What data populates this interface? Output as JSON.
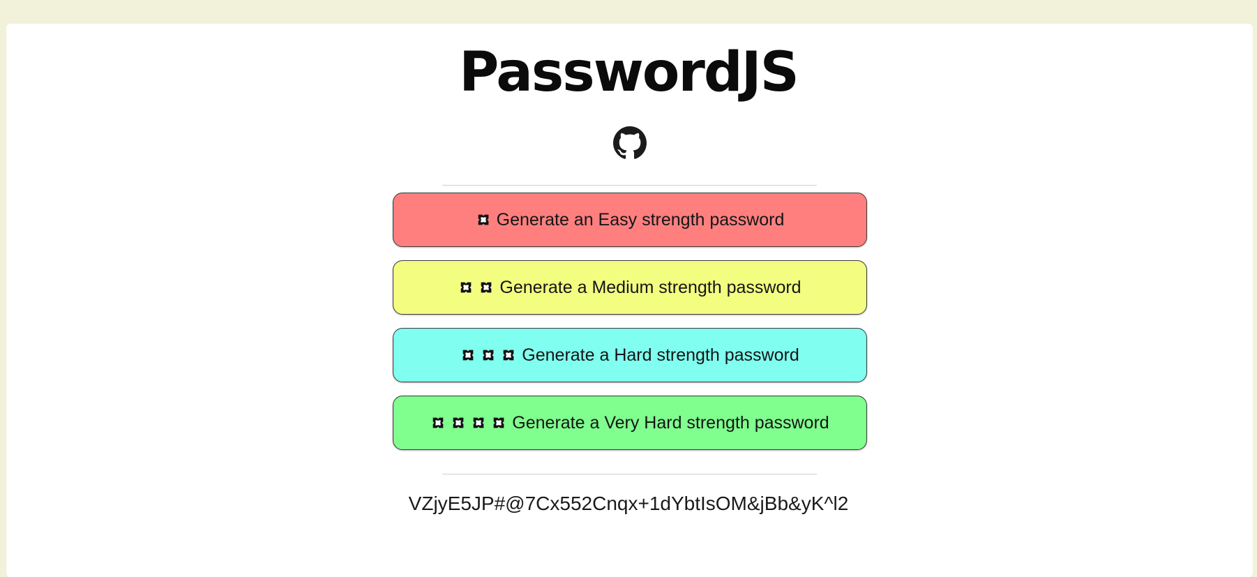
{
  "app": {
    "title": "PasswordJS"
  },
  "links": {
    "github_icon": "github-icon"
  },
  "buttons": [
    {
      "id": "easy",
      "label": "Generate an Easy strength password",
      "icon_count": 1,
      "color": "#ff7f7f",
      "icon": "spinner-icon"
    },
    {
      "id": "medium",
      "label": "Generate a Medium strength password",
      "icon_count": 2,
      "color": "#f3fd80",
      "icon": "spinner-icon"
    },
    {
      "id": "hard",
      "label": "Generate a Hard strength password",
      "icon_count": 3,
      "color": "#80fff0",
      "icon": "spinner-icon"
    },
    {
      "id": "very_hard",
      "label": "Generate a Very Hard strength password",
      "icon_count": 4,
      "color": "#80ff8f",
      "icon": "spinner-icon"
    }
  ],
  "output": {
    "password": "VZjyE5JP#@7Cx552Cnqx+1dYbtIsOM&jBb&yK^l2"
  },
  "colors": {
    "page_background": "#f2f1d9",
    "card_background": "#ffffff",
    "divider": "#cfcfcf"
  }
}
